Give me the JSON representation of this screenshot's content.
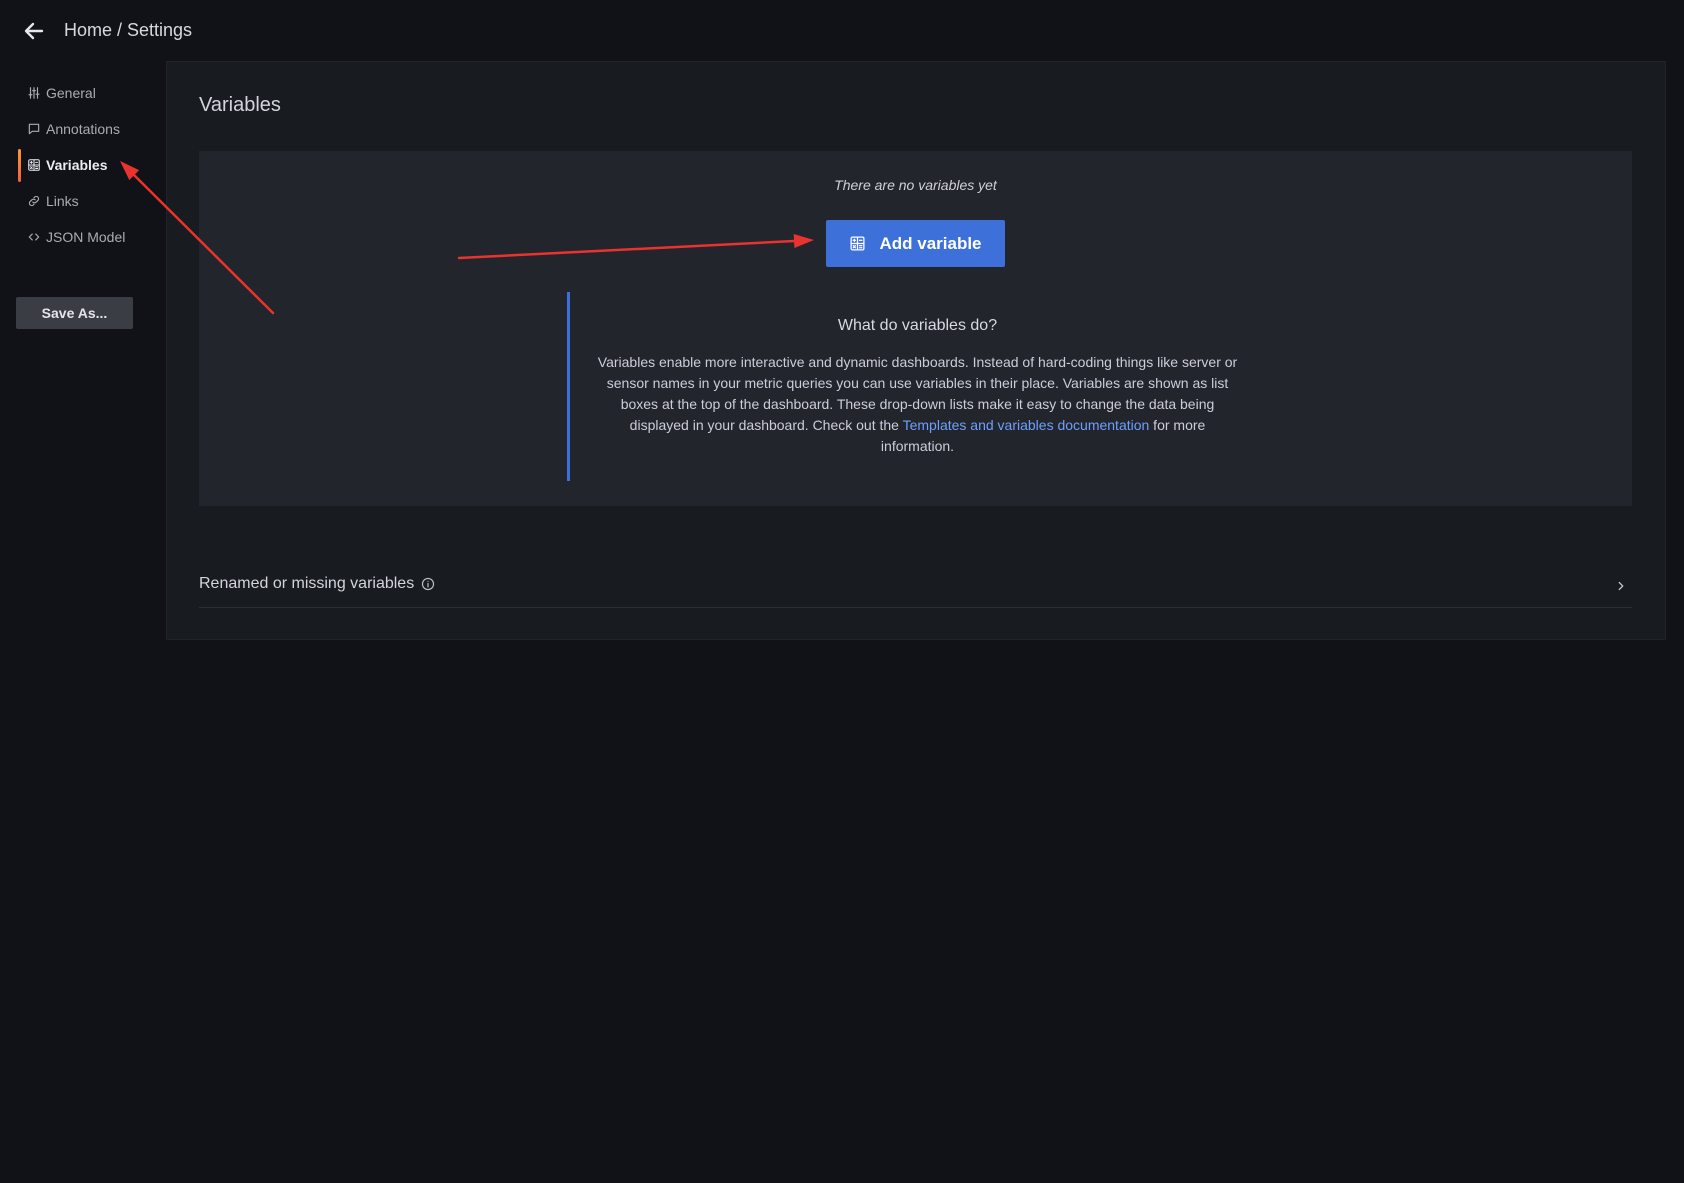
{
  "header": {
    "back_icon": "arrow-left-icon",
    "breadcrumb": "Home / Settings"
  },
  "sidebar": {
    "items": [
      {
        "label": "General",
        "icon": "sliders-icon",
        "active": false
      },
      {
        "label": "Annotations",
        "icon": "comment-icon",
        "active": false
      },
      {
        "label": "Variables",
        "icon": "calculator-icon",
        "active": true
      },
      {
        "label": "Links",
        "icon": "link-icon",
        "active": false
      },
      {
        "label": "JSON Model",
        "icon": "code-icon",
        "active": false
      }
    ],
    "save_as_label": "Save As..."
  },
  "main": {
    "title": "Variables",
    "empty_state": {
      "message": "There are no variables yet",
      "add_button_label": "Add variable",
      "add_button_icon": "calculator-icon",
      "info_title": "What do variables do?",
      "info_text_before": "Variables enable more interactive and dynamic dashboards. Instead of hard-coding things like server or sensor names in your metric queries you can use variables in their place. Variables are shown as list boxes at the top of the dashboard. These drop-down lists make it easy to change the data being displayed in your dashboard. Check out the ",
      "info_link": "Templates and variables documentation",
      "info_text_after": " for more information."
    },
    "renamed_section": {
      "label": "Renamed or missing variables",
      "info_icon": "info-circle-icon",
      "expand_icon": "chevron-right-icon"
    }
  },
  "colors": {
    "background": "#111217",
    "panel": "#181b1f",
    "empty_box": "#22252b",
    "accent": "#3d71d9",
    "link": "#6e9fff",
    "active_indicator": "#ff9830",
    "annotation_arrow": "#e8332e"
  }
}
